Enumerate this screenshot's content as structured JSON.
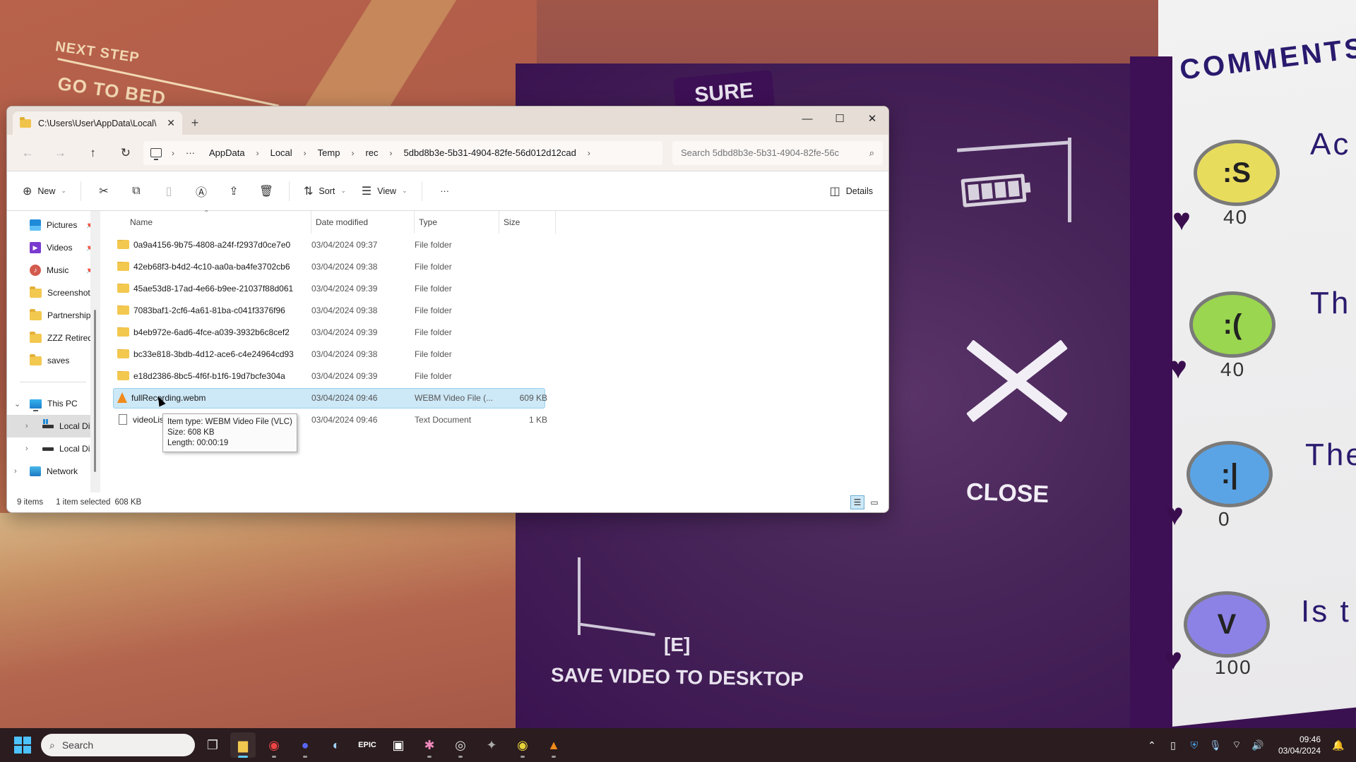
{
  "game": {
    "wall_text_top": "NEXT STEP",
    "wall_text_main": "GO TO BED",
    "tag_text": "SURE",
    "close_label": "CLOSE",
    "save_key": "[E]",
    "save_label": "SAVE VIDEO TO DESKTOP",
    "comments_title": "COMMENTS",
    "comments": [
      {
        "face": ":S",
        "face_color": "#e8dc5c",
        "likes": "40",
        "text": "Ac on"
      },
      {
        "face": ":(",
        "face_color": "#9ad64f",
        "likes": "40",
        "text": "Th"
      },
      {
        "face": ":|",
        "face_color": "#5aa4e6",
        "likes": "0",
        "text": "The"
      },
      {
        "face": "V",
        "face_color": "#8c82e6",
        "likes": "100",
        "text": "Is t"
      }
    ]
  },
  "explorer": {
    "tab_title": "C:\\Users\\User\\AppData\\Local\\",
    "tab_close": "✕",
    "new_tab": "+",
    "window_controls": {
      "minimize": "—",
      "maximize": "☐",
      "close": "✕"
    },
    "nav": {
      "back": "←",
      "forward": "→",
      "up": "↑",
      "refresh": "↻"
    },
    "breadcrumb": [
      "AppData",
      "Local",
      "Temp",
      "rec",
      "5dbd8b3e-5b31-4904-82fe-56d012d12cad"
    ],
    "breadcrumb_overflow": "···",
    "search_placeholder": "Search 5dbd8b3e-5b31-4904-82fe-56c",
    "toolbar": {
      "new": "New",
      "sort": "Sort",
      "view": "View",
      "more": "···",
      "details": "Details"
    },
    "sidebar": {
      "quick": [
        {
          "label": "Pictures",
          "icon": "pictures",
          "pinned": true
        },
        {
          "label": "Videos",
          "icon": "videos",
          "pinned": true
        },
        {
          "label": "Music",
          "icon": "music",
          "pinned": true
        },
        {
          "label": "Screenshots",
          "icon": "folder",
          "pinned": false
        },
        {
          "label": "Partnership M",
          "icon": "folder",
          "pinned": false
        },
        {
          "label": "ZZZ Retired",
          "icon": "folder",
          "pinned": false
        },
        {
          "label": "saves",
          "icon": "folder",
          "pinned": false
        }
      ],
      "this_pc": "This PC",
      "drives": [
        "Local Disk (",
        "Local Disk ("
      ],
      "network": "Network"
    },
    "columns": [
      "Name",
      "Date modified",
      "Type",
      "Size"
    ],
    "files": [
      {
        "name": "0a9a4156-9b75-4808-a24f-f2937d0ce7e0",
        "date": "03/04/2024 09:37",
        "type": "File folder",
        "size": "",
        "icon": "folder"
      },
      {
        "name": "42eb68f3-b4d2-4c10-aa0a-ba4fe3702cb6",
        "date": "03/04/2024 09:38",
        "type": "File folder",
        "size": "",
        "icon": "folder"
      },
      {
        "name": "45ae53d8-17ad-4e66-b9ee-21037f88d061",
        "date": "03/04/2024 09:39",
        "type": "File folder",
        "size": "",
        "icon": "folder"
      },
      {
        "name": "7083baf1-2cf6-4a61-81ba-c041f3376f96",
        "date": "03/04/2024 09:38",
        "type": "File folder",
        "size": "",
        "icon": "folder"
      },
      {
        "name": "b4eb972e-6ad6-4fce-a039-3932b6c8cef2",
        "date": "03/04/2024 09:39",
        "type": "File folder",
        "size": "",
        "icon": "folder"
      },
      {
        "name": "bc33e818-3bdb-4d12-ace6-c4e24964cd93",
        "date": "03/04/2024 09:38",
        "type": "File folder",
        "size": "",
        "icon": "folder"
      },
      {
        "name": "e18d2386-8bc5-4f6f-b1f6-19d7bcfe304a",
        "date": "03/04/2024 09:39",
        "type": "File folder",
        "size": "",
        "icon": "folder"
      },
      {
        "name": "fullRecording.webm",
        "date": "03/04/2024 09:46",
        "type": "WEBM Video File (...",
        "size": "609 KB",
        "icon": "vlc",
        "selected": true
      },
      {
        "name": "videoList.txt",
        "date": "03/04/2024 09:46",
        "type": "Text Document",
        "size": "1 KB",
        "icon": "text"
      }
    ],
    "tooltip": [
      "Item type: WEBM Video File (VLC)",
      "Size: 608 KB",
      "Length: 00:00:19"
    ],
    "status": {
      "count": "9 items",
      "selected": "1 item selected",
      "size": "608 KB"
    }
  },
  "taskbar": {
    "search_label": "Search",
    "apps": [
      "Task View",
      "File Explorer",
      "Chrome",
      "Discord",
      "Steam",
      "Epic Games",
      "Microsoft Store",
      "Slack",
      "OBS",
      "GIMP",
      "Eye app",
      "VLC"
    ],
    "time": "09:46",
    "date": "03/04/2024"
  }
}
